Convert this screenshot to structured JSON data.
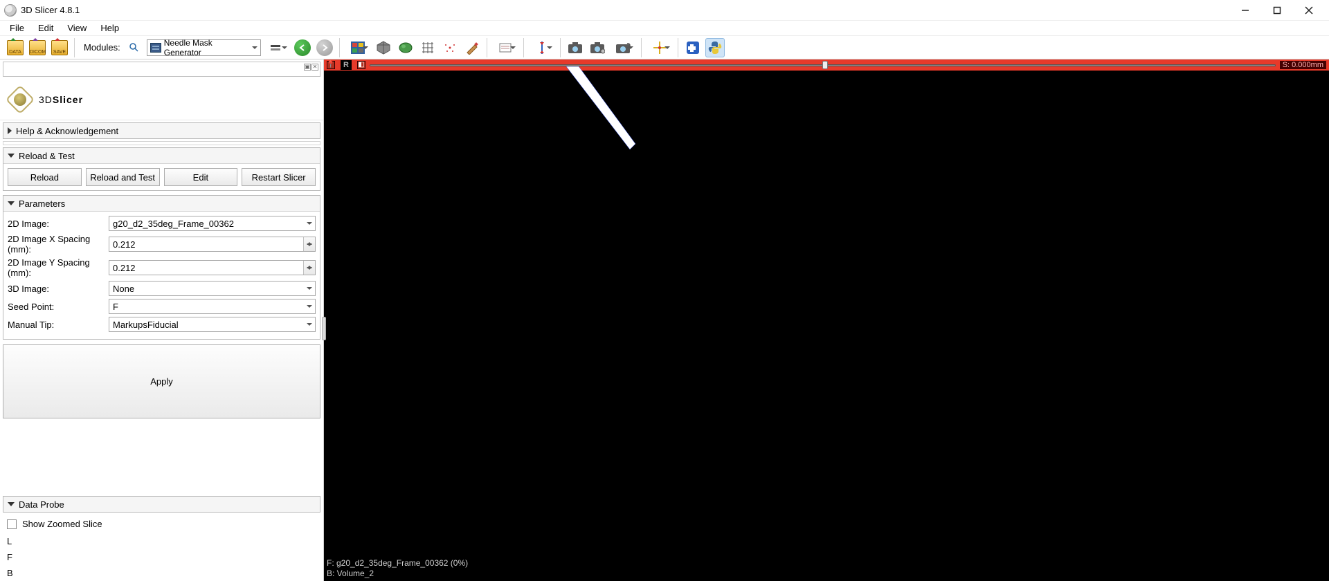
{
  "title": "3D Slicer 4.8.1",
  "menubar": [
    "File",
    "Edit",
    "View",
    "Help"
  ],
  "toolbar": {
    "data_label": "DATA",
    "dicom_label": "DICOM",
    "save_label": "SAVE",
    "modules_label": "Modules:",
    "modules_selected": "Needle Mask Generator"
  },
  "logo_text_a": "3D",
  "logo_text_b": "Slicer",
  "sections": {
    "help_ack": "Help & Acknowledgement",
    "reload_test": "Reload & Test",
    "parameters": "Parameters",
    "data_probe": "Data Probe"
  },
  "reload_buttons": {
    "reload": "Reload",
    "reload_and_test": "Reload and Test",
    "edit": "Edit",
    "restart": "Restart Slicer"
  },
  "params": {
    "image2d_label": "2D Image:",
    "image2d_value": "g20_d2_35deg_Frame_00362",
    "xspacing_label": "2D Image X Spacing (mm):",
    "xspacing_value": "0.212",
    "yspacing_label": "2D Image Y Spacing (mm):",
    "yspacing_value": "0.212",
    "image3d_label": "3D Image:",
    "image3d_value": "None",
    "seed_label": "Seed Point:",
    "seed_value": "F",
    "tip_label": "Manual Tip:",
    "tip_value": "MarkupsFiducial",
    "apply_label": "Apply"
  },
  "dataprobe": {
    "show_zoom": "Show Zoomed Slice",
    "L": "L",
    "F": "F",
    "B": "B"
  },
  "viewport": {
    "orient": "R",
    "slice_pos": "S: 0.000mm",
    "overlay_f": "F: g20_d2_35deg_Frame_00362 (0%)",
    "overlay_b": "B: Volume_2"
  }
}
